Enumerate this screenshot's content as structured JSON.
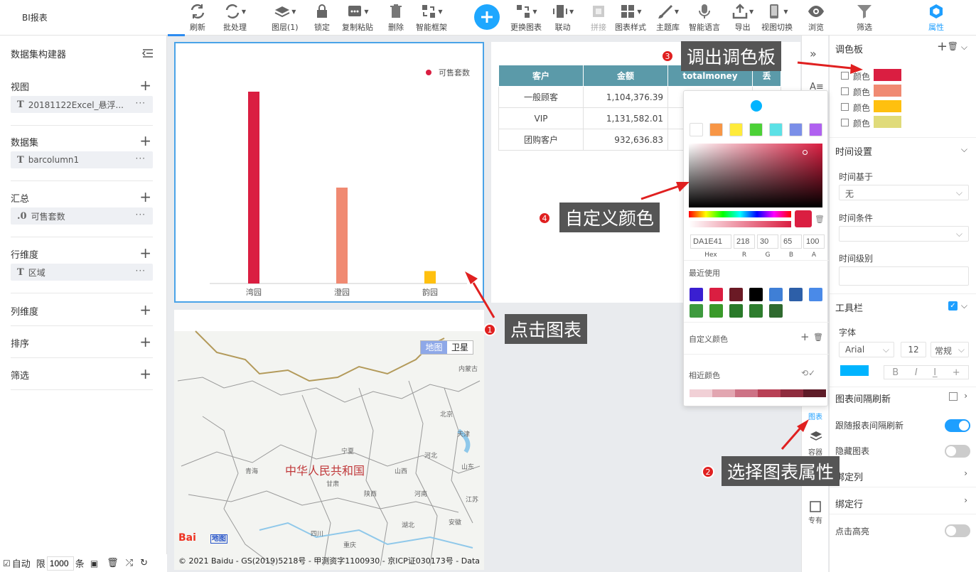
{
  "app_title": "BI报表",
  "toolbar": [
    {
      "label": "刷新",
      "icon": "refresh-icon"
    },
    {
      "label": "批处理",
      "icon": "batch-icon"
    },
    {
      "label": "图层(1)",
      "icon": "layers-icon"
    },
    {
      "label": "锁定",
      "icon": "lock-icon"
    },
    {
      "label": "复制粘贴",
      "icon": "copy-paste-icon"
    },
    {
      "label": "删除",
      "icon": "trash-icon"
    },
    {
      "label": "智能框架",
      "icon": "smart-frame-icon"
    },
    {
      "label": "更换图表",
      "icon": "swap-chart-icon"
    },
    {
      "label": "联动",
      "icon": "link-icon"
    },
    {
      "label": "拼接",
      "icon": "splice-icon"
    },
    {
      "label": "图表样式",
      "icon": "chart-style-icon"
    },
    {
      "label": "主题库",
      "icon": "theme-brush-icon"
    },
    {
      "label": "智能语言",
      "icon": "microphone-icon"
    },
    {
      "label": "导出",
      "icon": "export-icon"
    },
    {
      "label": "视图切换",
      "icon": "device-icon"
    },
    {
      "label": "浏览",
      "icon": "eye-icon"
    },
    {
      "label": "筛选",
      "icon": "filter-icon"
    },
    {
      "label": "属性",
      "icon": "hexagon-icon"
    }
  ],
  "left_panel": {
    "title": "数据集构建器",
    "sections": [
      {
        "title": "视图",
        "item": "20181122Excel_悬浮...",
        "prefix": "T"
      },
      {
        "title": "数据集",
        "item": "barcolumn1",
        "prefix": "T"
      },
      {
        "title": "汇总",
        "item": "可售套数",
        "prefix": ".0"
      },
      {
        "title": "行维度",
        "item": "区域",
        "prefix": "T"
      },
      {
        "title": "列维度"
      },
      {
        "title": "排序"
      },
      {
        "title": "筛选"
      }
    ],
    "bottom": {
      "auto_label": "自动",
      "limit_label": "限",
      "limit_value": "1000",
      "unit": "条"
    }
  },
  "chart_data": {
    "type": "bar",
    "categories": [
      "湾园",
      "澄园",
      "韵园"
    ],
    "series": [
      {
        "name": "可售套数",
        "values": [
          100,
          50,
          6.5
        ]
      }
    ],
    "colors": [
      "#DA1E41",
      "#F08A72",
      "#FFC00F"
    ],
    "legend": "top-right",
    "grid": false
  },
  "table": {
    "headers": [
      "客户",
      "金额",
      "totalmoney",
      "丢"
    ],
    "rows": [
      [
        "一般顾客",
        "1,104,376.39"
      ],
      [
        "VIP",
        "1,131,582.01"
      ],
      [
        "团购客户",
        "932,636.83"
      ]
    ]
  },
  "map": {
    "tab_map": "地图",
    "tab_satellite": "卫星",
    "country": "中华人民共和国",
    "labels": [
      "内蒙古",
      "北京",
      "天津",
      "宁夏",
      "河北",
      "青海",
      "甘肃",
      "山西",
      "山东",
      "陕西",
      "河南",
      "江苏",
      "四川",
      "湖北",
      "安徽",
      "重庆"
    ],
    "copyright": "© 2021 Baidu - GS(2019)5218号 - 甲测资字1100930 - 京ICP证030173号 - Data",
    "logo_text": "Bai",
    "logo_suffix": "地图"
  },
  "color_picker": {
    "presets": [
      "#ffffff",
      "#f79646",
      "#ffeb3b",
      "#4cd137",
      "#5ce1e6",
      "#7b8fe8",
      "#b061f0"
    ],
    "current_color": "#DA1E41",
    "hex": "DA1E41",
    "r": "218",
    "g": "30",
    "b": "65",
    "a": "100",
    "hex_label": "Hex",
    "r_label": "R",
    "g_label": "G",
    "b_label": "B",
    "a_label": "A",
    "recent_label": "最近使用",
    "recent": [
      "#3a1fd1",
      "#da1e41",
      "#6b1a25",
      "#000000",
      "#3f7fd6",
      "#2d5fa8",
      "#4a8ae8",
      "#3e9a3e",
      "#3a9a2a",
      "#2a7a2a",
      "#2e7d2e",
      "#2f6a2f"
    ],
    "custom_label": "自定义颜色",
    "similar_label": "相近颜色",
    "similar": [
      "#f1d0d6",
      "#e2a6b1",
      "#cd7285",
      "#b84055",
      "#8f2c3e",
      "#5e1c28"
    ]
  },
  "right_strip": {
    "chart_label": "图表",
    "container_label": "容器",
    "exclusive_label": "专有"
  },
  "right_panel": {
    "palette_title": "调色板",
    "palette": [
      {
        "label": "颜色",
        "color": "#DA1E41"
      },
      {
        "label": "颜色",
        "color": "#F08A72"
      },
      {
        "label": "颜色",
        "color": "#FFC00F"
      },
      {
        "label": "颜色",
        "color": "#E0DB7A"
      }
    ],
    "time_title": "时间设置",
    "time_base_label": "时间基于",
    "time_base_value": "无",
    "time_cond_label": "时间条件",
    "time_level_label": "时间级别",
    "toolbar_title": "工具栏",
    "font_label": "字体",
    "font_family": "Arial",
    "font_size": "12",
    "font_weight": "常规",
    "font_color": "#00b4ff",
    "interval_title": "图表间隔刷新",
    "follow_label": "跟随报表间隔刷新",
    "hide_label": "隐藏图表",
    "bind_col_label": "绑定列",
    "bind_row_label": "绑定行",
    "highlight_label": "点击高亮"
  },
  "callouts": [
    {
      "num": "1",
      "text": "点击图表"
    },
    {
      "num": "2",
      "text": "选择图表属性"
    },
    {
      "num": "3",
      "text": "调出调色板"
    },
    {
      "num": "4",
      "text": "自定义颜色"
    }
  ]
}
